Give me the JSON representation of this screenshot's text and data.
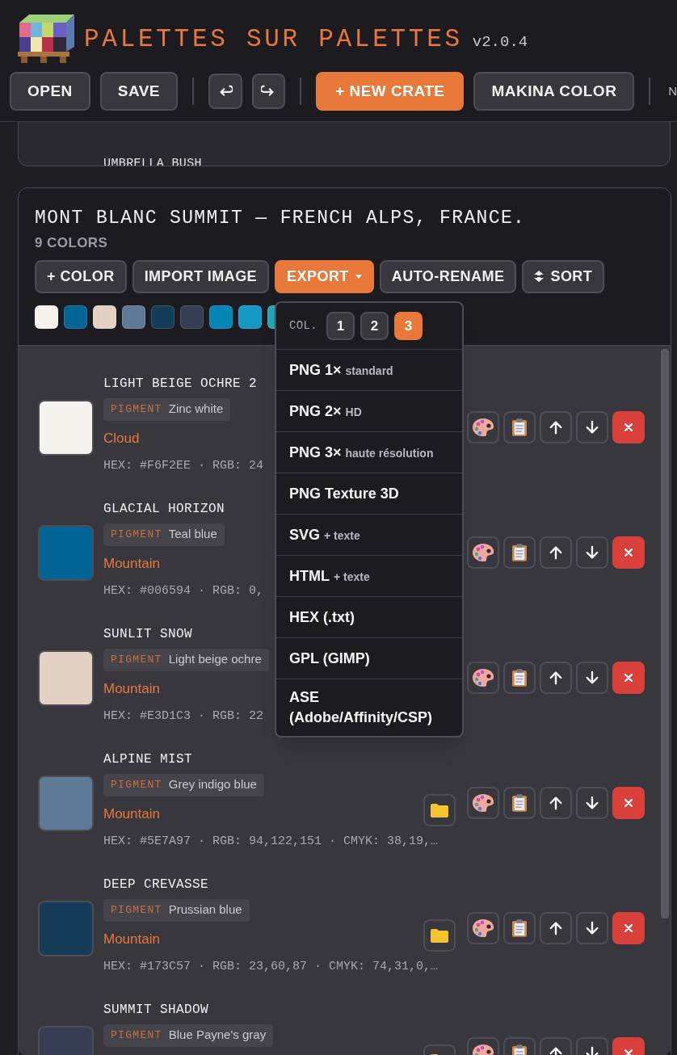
{
  "app": {
    "title": "PALETTES SUR PALETTES",
    "version": "v2.0.4"
  },
  "toolbar": [
    {
      "kind": "button",
      "label": "OPEN"
    },
    {
      "kind": "button",
      "label": "SAVE"
    },
    {
      "kind": "divider"
    },
    {
      "kind": "undo"
    },
    {
      "kind": "redo"
    },
    {
      "kind": "divider"
    },
    {
      "kind": "primary",
      "label": "+ NEW CRATE"
    },
    {
      "kind": "button",
      "label": "MAKINA COLOR"
    },
    {
      "kind": "divider"
    },
    {
      "kind": "cut",
      "label": "N"
    }
  ],
  "previous_card": {
    "last_name": "UMBRELLA BUSH"
  },
  "card": {
    "title": "MONT BLANC SUMMIT — FRENCH ALPS, FRANCE.",
    "count": "9 COLORS",
    "actions": [
      {
        "kind": "plain",
        "label": "+ COLOR",
        "highlighted": false
      },
      {
        "kind": "plain",
        "label": "IMPORT IMAGE",
        "highlighted": false
      },
      {
        "kind": "menu",
        "label": "EXPORT",
        "highlighted": true
      },
      {
        "kind": "plain",
        "label": "AUTO-RENAME",
        "highlighted": false
      },
      {
        "kind": "sort",
        "label": "SORT",
        "highlighted": false
      }
    ],
    "swatches": [
      {
        "color": "#f6f2ee"
      },
      {
        "color": "#006594"
      },
      {
        "color": "#e3d1c3"
      },
      {
        "color": "#5e7a97"
      },
      {
        "color": "#173c57"
      },
      {
        "color": "#373d55"
      },
      {
        "color": "#0085b4"
      },
      {
        "color": "#1598c4"
      },
      {
        "color": "#2aa3b8"
      }
    ],
    "rows": [
      {
        "name": "LIGHT BEIGE OCHRE 2",
        "pigment_label": "PIGMENT",
        "pigment": "Zinc white",
        "tag": "Cloud",
        "codes": "HEX: #F6F2EE · RGB: 24",
        "color": "#f6f2ee",
        "folder": false
      },
      {
        "name": "GLACIAL HORIZON",
        "pigment_label": "PIGMENT",
        "pigment": "Teal blue",
        "tag": "Mountain",
        "codes": "HEX: #006594 · RGB: 0,",
        "color": "#006594",
        "folder": false
      },
      {
        "name": "SUNLIT SNOW",
        "pigment_label": "PIGMENT",
        "pigment": "Light beige ochre",
        "tag": "Mountain",
        "codes": "HEX: #E3D1C3 · RGB: 22",
        "color": "#e3d1c3",
        "folder": false
      },
      {
        "name": "ALPINE MIST",
        "pigment_label": "PIGMENT",
        "pigment": "Grey indigo blue",
        "tag": "Mountain",
        "codes": "HEX: #5E7A97 · RGB: 94,122,151 · CMYK: 38,19,…",
        "color": "#5e7a97",
        "folder": true
      },
      {
        "name": "DEEP CREVASSE",
        "pigment_label": "PIGMENT",
        "pigment": "Prussian blue",
        "tag": "Mountain",
        "codes": "HEX: #173C57 · RGB: 23,60,87 · CMYK: 74,31,0,…",
        "color": "#173c57",
        "folder": true
      },
      {
        "name": "SUMMIT SHADOW",
        "pigment_label": "PIGMENT",
        "pigment": "Blue Payne's gray",
        "color": "#373d55",
        "folder": true
      }
    ]
  },
  "export_menu": {
    "columns_label": "COL.",
    "columns": [
      {
        "label": "1",
        "selected": false
      },
      {
        "label": "2",
        "selected": false
      },
      {
        "label": "3",
        "selected": true
      }
    ],
    "items": [
      {
        "label": "PNG 1×",
        "note": "standard"
      },
      {
        "label": "PNG 2×",
        "note": "HD"
      },
      {
        "label": "PNG 3×",
        "note": "haute résolution"
      },
      {
        "label": "PNG Texture 3D"
      },
      {
        "label": "SVG",
        "note": "+ texte"
      },
      {
        "label": "HTML",
        "note": "+ texte"
      },
      {
        "label": "HEX (.txt)"
      },
      {
        "label": "GPL (GIMP)"
      },
      {
        "label": "ASE (Adobe/Affinity/CSP)"
      }
    ]
  }
}
